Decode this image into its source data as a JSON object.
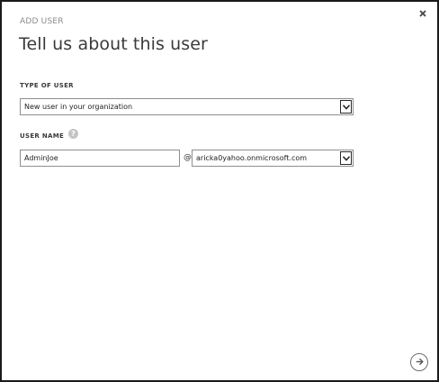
{
  "dialog": {
    "eyebrow": "ADD USER",
    "title": "Tell us about this user"
  },
  "type_of_user": {
    "label": "TYPE OF USER",
    "selected": "New user in your organization"
  },
  "user_name": {
    "label": "USER NAME",
    "help_icon": "?",
    "value": "AdminJoe",
    "at_symbol": "@",
    "domain_selected": "aricka0yahoo.onmicrosoft.com"
  },
  "icons": {
    "close": "close-icon",
    "next": "arrow-right-circle-icon",
    "help": "question-icon",
    "dropdown": "chevron-down-icon"
  },
  "colors": {
    "border": "#1a1a1a",
    "text": "#3a3a3a",
    "muted": "#8a8a8a",
    "help_bg": "#c4c4c4"
  }
}
